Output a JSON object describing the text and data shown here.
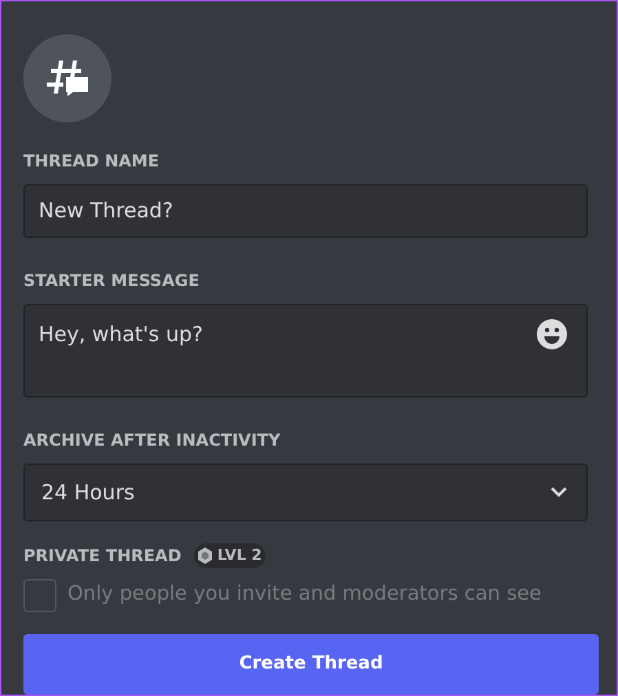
{
  "thread_name": {
    "label": "THREAD NAME",
    "value": "New Thread?"
  },
  "starter_message": {
    "label": "STARTER MESSAGE",
    "value": "Hey, what's up?"
  },
  "archive": {
    "label": "ARCHIVE AFTER INACTIVITY",
    "value": "24 Hours"
  },
  "private_thread": {
    "label": "PRIVATE THREAD",
    "badge": "LVL 2",
    "checkbox_label": "Only people you invite and moderators can see",
    "checked": false,
    "disabled": true
  },
  "button": "Create Thread"
}
